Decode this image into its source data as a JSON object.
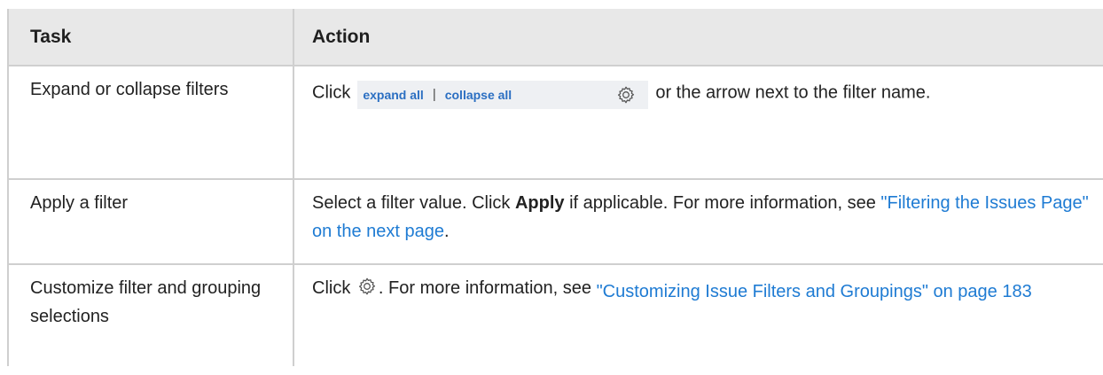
{
  "table": {
    "headers": {
      "task": "Task",
      "action": "Action"
    },
    "rows": [
      {
        "task": "Expand or collapse filters",
        "action_prefix": "Click",
        "expand_label": "expand all",
        "separator": "|",
        "collapse_label": "collapse all",
        "action_suffix": "or the arrow next to the filter name."
      },
      {
        "task": "Apply a filter",
        "action_part1": "Select a filter value. Click",
        "action_bold": "Apply",
        "action_part2": "if applicable. For more information, see",
        "action_link": "\"Filtering the Issues Page\" on the next page",
        "action_end": "."
      },
      {
        "task": "Customize filter and grouping selections",
        "action_prefix": "Click",
        "action_mid": ". For more information, see",
        "action_link": "\"Customizing Issue Filters and Groupings\" on page 183"
      }
    ]
  },
  "icons": {
    "gear": "gear-icon"
  },
  "colors": {
    "link": "#1e7bd3",
    "header_bg": "#e8e8e8",
    "border": "#cfcfcf"
  }
}
